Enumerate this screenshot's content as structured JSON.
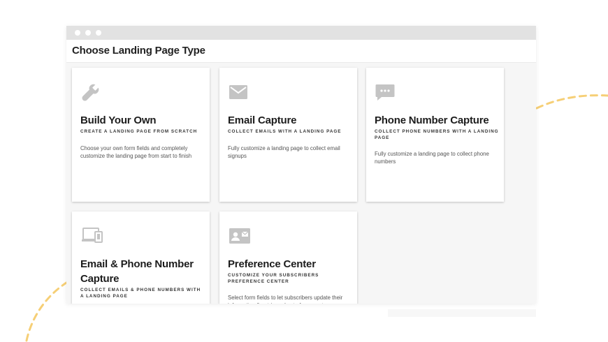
{
  "window": {
    "title": "Choose Landing Page Type"
  },
  "cards": [
    {
      "icon": "wrench-icon",
      "title": "Build Your Own",
      "subtitle": "Create a landing page from scratch",
      "description": "Choose your own form fields and completely customize the landing page from start to finish"
    },
    {
      "icon": "envelope-icon",
      "title": "Email Capture",
      "subtitle": "Collect emails with a landing page",
      "description": "Fully customize a landing page to collect email signups"
    },
    {
      "icon": "chat-bubble-icon",
      "title": "Phone Number Capture",
      "subtitle": "Collect phone numbers with a landing page",
      "description": "Fully customize a landing page to collect phone numbers"
    },
    {
      "icon": "devices-icon",
      "title": "Email & Phone Number Capture",
      "subtitle": "Collect emails & phone numbers with a landing page",
      "description": ""
    },
    {
      "icon": "contact-card-icon",
      "title": "Preference Center",
      "subtitle": "Customize your subscribers preference center",
      "description": "Select form fields to let subscribers update their information & opt-in and out of segments"
    }
  ],
  "colors": {
    "icon": "#c4c4c4",
    "decoration": "#f6cf76",
    "titlebar": "#e2e2e2"
  }
}
